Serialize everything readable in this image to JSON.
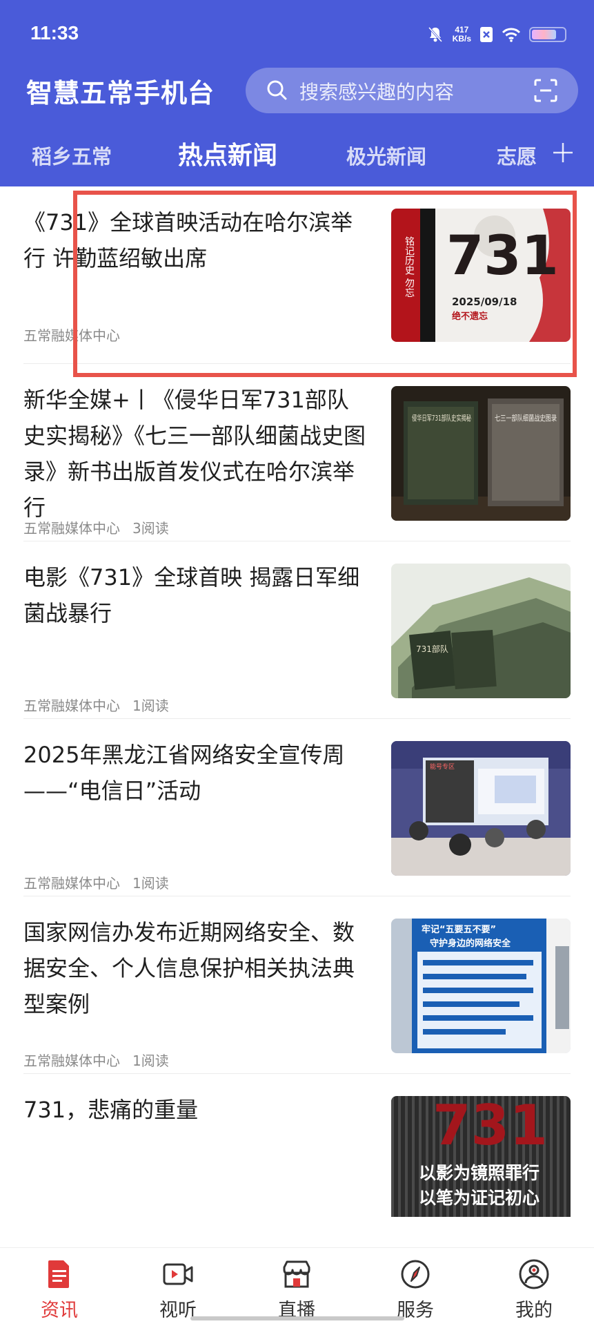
{
  "status": {
    "time": "11:33",
    "net_speed_value": "417",
    "net_speed_unit": "KB/s"
  },
  "header": {
    "app_title": "智慧五常手机台",
    "search_placeholder": "搜索感兴趣的内容"
  },
  "tabs": [
    {
      "label": "稻乡五常",
      "active": false
    },
    {
      "label": "热点新闻",
      "active": true
    },
    {
      "label": "极光新闻",
      "active": false
    },
    {
      "label": "志愿",
      "active": false
    }
  ],
  "feed": [
    {
      "title": "《731》全球首映活动在哈尔滨举行 许勤蓝绍敏出席",
      "source": "五常融媒体中心",
      "reads": "",
      "thumb_text": [
        "731",
        "2025/09/18",
        "绝不遗忘",
        "铭记历史 勿忘"
      ]
    },
    {
      "title": "新华全媒+丨《侵华日军731部队史实揭秘》《七三一部队细菌战史图录》新书出版首发仪式在哈尔滨举行",
      "source": "五常融媒体中心",
      "reads": "3阅读",
      "thumb_text": [
        "侵华日军731部队史实揭秘",
        "七三一部队细菌战史图录"
      ]
    },
    {
      "title": "电影《731》全球首映 揭露日军细菌战暴行",
      "source": "五常融媒体中心",
      "reads": "1阅读",
      "thumb_text": [
        "731部队"
      ]
    },
    {
      "title": "2025年黑龙江省网络安全宣传周——“电信日”活动",
      "source": "五常融媒体中心",
      "reads": "1阅读",
      "thumb_text": [
        "能号专区"
      ]
    },
    {
      "title": "国家网信办发布近期网络安全、数据安全、个人信息保护相关执法典型案例",
      "source": "五常融媒体中心",
      "reads": "1阅读",
      "thumb_text": [
        "牢记“五要五不要”",
        "守护身边的网络安全"
      ]
    },
    {
      "title": "731，悲痛的重量",
      "source": "",
      "reads": "",
      "thumb_text": [
        "731",
        "以影为镜照罪行",
        "以笔为证记初心"
      ]
    }
  ],
  "bottom_nav": [
    {
      "label": "资讯",
      "icon": "news-icon",
      "active": true
    },
    {
      "label": "视听",
      "icon": "video-icon",
      "active": false
    },
    {
      "label": "直播",
      "icon": "live-store-icon",
      "active": false
    },
    {
      "label": "服务",
      "icon": "compass-icon",
      "active": false
    },
    {
      "label": "我的",
      "icon": "profile-icon",
      "active": false
    }
  ],
  "colors": {
    "header_bg": "#4a5bd9",
    "accent_red": "#e03a3a",
    "highlight": "#e8534a"
  }
}
